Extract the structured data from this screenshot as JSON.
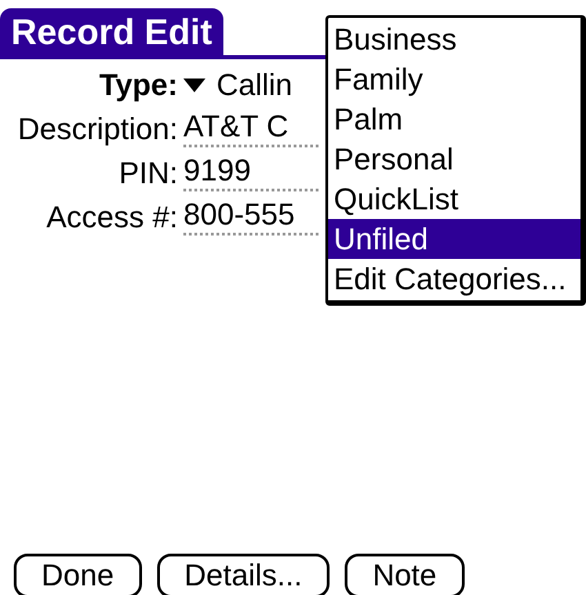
{
  "window": {
    "title": "Record Edit"
  },
  "fields": [
    {
      "label": "Type:",
      "value": "Callin",
      "kind": "dropdown"
    },
    {
      "label": "Description:",
      "value": "AT&T C",
      "kind": "text"
    },
    {
      "label": "PIN:",
      "value": "9199",
      "kind": "text"
    },
    {
      "label": "Access #:",
      "value": "800-555",
      "kind": "text"
    }
  ],
  "category_menu": [
    {
      "label": "Business",
      "selected": false
    },
    {
      "label": "Family",
      "selected": false
    },
    {
      "label": "Palm",
      "selected": false
    },
    {
      "label": "Personal",
      "selected": false
    },
    {
      "label": "QuickList",
      "selected": false
    },
    {
      "label": "Unfiled",
      "selected": true
    },
    {
      "label": "Edit Categories...",
      "selected": false
    }
  ],
  "buttons": [
    "Done",
    "Details...",
    "Note"
  ]
}
